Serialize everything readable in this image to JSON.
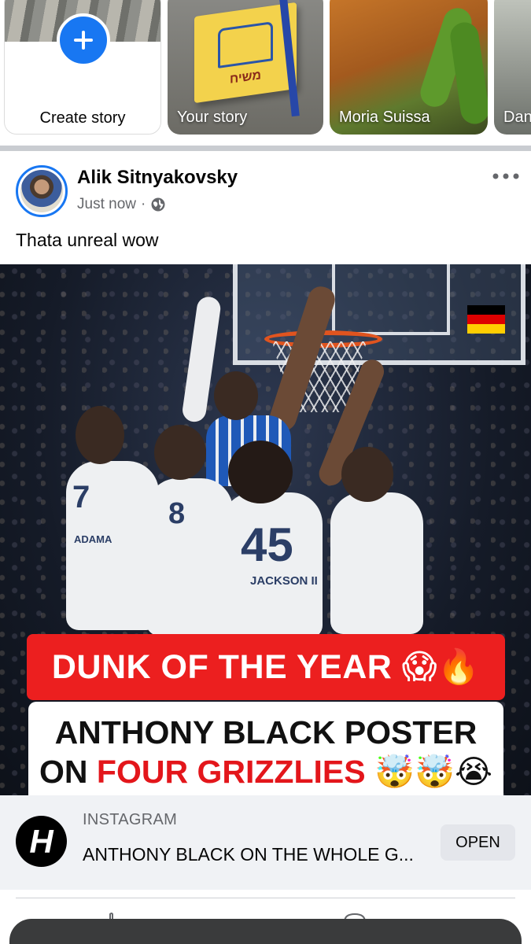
{
  "stories": {
    "create": {
      "label": "Create story"
    },
    "items": [
      {
        "label": "Your story"
      },
      {
        "label": "Moria Suissa"
      },
      {
        "label": "Dan"
      }
    ]
  },
  "post": {
    "author": "Alik Sitnyakovsky",
    "timestamp": "Just now",
    "separator": "·",
    "privacy_icon": "globe-icon",
    "text": "Thata unreal wow",
    "media": {
      "flag_text": "משיח",
      "jersey_numbers": [
        "7",
        "8",
        "45"
      ],
      "jersey_names": [
        "ADAMA",
        "JACKSON II"
      ],
      "banner_red": "DUNK OF THE YEAR 😱🔥",
      "banner_line1": "ANTHONY BLACK POSTER",
      "banner_line2_prefix": "ON ",
      "banner_line2_red": "FOUR GRIZZLIES",
      "banner_line2_emoji": " 🤯🤯😭"
    },
    "link": {
      "logo_letter": "H",
      "source": "INSTAGRAM",
      "title": "ANTHONY BLACK ON THE WHOLE G...",
      "open_label": "OPEN"
    }
  },
  "colors": {
    "accent": "#1877f2",
    "banner_red": "#ec1f1f",
    "secondary_text": "#65676b"
  }
}
